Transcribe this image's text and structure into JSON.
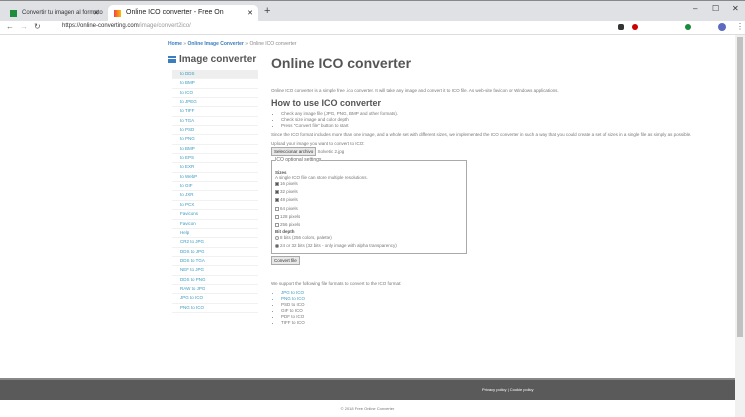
{
  "browser": {
    "tabs": [
      {
        "title": "Convertir tu imagen al formato"
      },
      {
        "title": "Online ICO converter - Free On"
      }
    ],
    "url_host": "https://online-converting.com",
    "url_path": "/image/convert2ico/"
  },
  "breadcrumb": {
    "home": "Home",
    "section": "Online Image Converter",
    "current": "Online ICO converter",
    "sep": " » "
  },
  "sidebar": {
    "title": "Image converter",
    "items": [
      "to DDS",
      "to BMP",
      "to ICO",
      "to JPEG",
      "to TIFF",
      "to TGA",
      "to PSD",
      "to PNG",
      "to BMP",
      "to EPS",
      "to EXR",
      "to WebP",
      "to GIF",
      "to JXR",
      "to PCX",
      "Favicons",
      "Favicon",
      "Help",
      "CR2 to JPG",
      "DDS to JPG",
      "DDS to TGA",
      "NEF to JPG",
      "DDS to PNG",
      "RAW to JPG",
      "JPG to ICO",
      "PNG to ICO"
    ]
  },
  "main": {
    "title": "Online ICO converter",
    "intro": "Online ICO converter is a simple free .ico converter. It will take any image and convert it to ICO file. As web-site favicon or Windows applications.",
    "howto_title": "How to use ICO converter",
    "steps": [
      "Check any image file (JPG, PNG, BMP and other formats).",
      "Check size image and color depth",
      "Press \"Convert file\" button to start"
    ],
    "note": "Since the ICO format includes more than one image, and a whole set with different sizes, we implemented the ICO converter in such a way that you could create a set of sizes in a single file as simply as possible.",
    "upload_label": "Upload your image you want to convert to ICO:",
    "file_button": "Seleccionar archivo",
    "file_name": "Solvetic 2.jpg",
    "settings_legend": "ICO optional settings",
    "size_label": "Sizes",
    "size_hint": "A single ICO file can store multiple resolutions.",
    "sizes": [
      {
        "label": "16 pixels",
        "checked": true
      },
      {
        "label": "32 pixels",
        "checked": true
      },
      {
        "label": "48 pixels",
        "checked": true
      },
      {
        "label": "64 pixels",
        "checked": false
      },
      {
        "label": "128 pixels",
        "checked": false
      },
      {
        "label": "256 pixels",
        "checked": false
      }
    ],
    "depth_label": "Bit depth",
    "depths": [
      {
        "label": "8 bits (256 colors, palette)",
        "checked": false
      },
      {
        "label": "24 or 32 bits (32 bits - only image with alpha transparency)",
        "checked": true
      }
    ],
    "convert_button": "Convert file",
    "formats_intro": "We support the following file formats to convert to the ICO format:",
    "formats": [
      "JPG to ICO",
      "PNG to ICO",
      "PSD to ICO",
      "GIF to ICO",
      "PDF to ICO",
      "TIFF to ICO"
    ]
  },
  "footer": {
    "links": "Privacy policy | Cookie policy",
    "copyright": "© 2018 Free Online Converter"
  }
}
